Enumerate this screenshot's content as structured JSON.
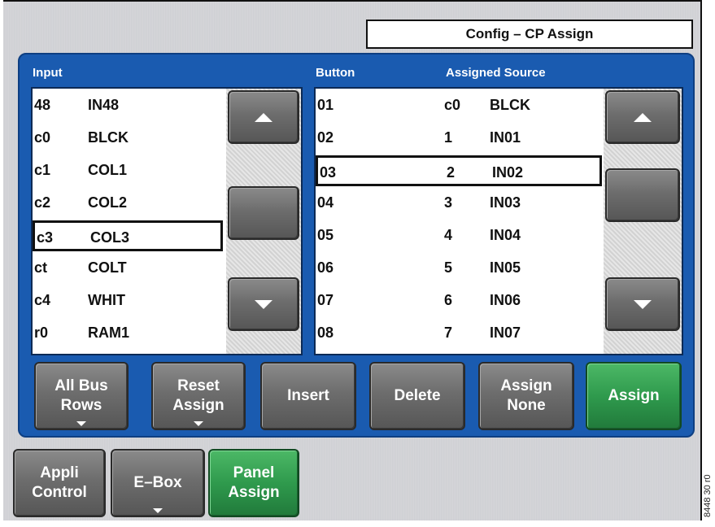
{
  "window": {
    "title": "Config – CP Assign"
  },
  "input_list": {
    "header": "Input",
    "rows": [
      {
        "code": "48",
        "name": "IN48"
      },
      {
        "code": "c0",
        "name": "BLCK"
      },
      {
        "code": "c1",
        "name": "COL1"
      },
      {
        "code": "c2",
        "name": "COL2"
      },
      {
        "code": "c3",
        "name": "COL3",
        "selected": true
      },
      {
        "code": "ct",
        "name": "COLT"
      },
      {
        "code": "c4",
        "name": "WHIT"
      },
      {
        "code": "r0",
        "name": "RAM1"
      }
    ]
  },
  "assign_list": {
    "header_button": "Button",
    "header_source": "Assigned Source",
    "rows": [
      {
        "button": "01",
        "code": "c0",
        "source": "BLCK"
      },
      {
        "button": "02",
        "code": "1",
        "source": "IN01"
      },
      {
        "button": "03",
        "code": "2",
        "source": "IN02",
        "selected": true
      },
      {
        "button": "04",
        "code": "3",
        "source": "IN03"
      },
      {
        "button": "05",
        "code": "4",
        "source": "IN04"
      },
      {
        "button": "06",
        "code": "5",
        "source": "IN05"
      },
      {
        "button": "07",
        "code": "6",
        "source": "IN06"
      },
      {
        "button": "08",
        "code": "7",
        "source": "IN07"
      }
    ]
  },
  "actions": {
    "all_bus_rows": "All Bus Rows",
    "reset_assign": "Reset Assign",
    "insert": "Insert",
    "delete": "Delete",
    "assign_none": "Assign None",
    "assign": "Assign"
  },
  "bottom_tabs": {
    "appli_control": "Appli Control",
    "e_box": "E–Box",
    "panel_assign": "Panel Assign"
  },
  "icons": {
    "scroll_up": "triangle-up-icon",
    "scroll_down": "triangle-down-icon",
    "menu_indicator": "small-down-triangle-icon"
  },
  "colors": {
    "panel_blue": "#1a5bb0",
    "active_green": "#2f9a4d",
    "button_gray": "#6d6d6d"
  },
  "figure_id": "8448 30 r0"
}
